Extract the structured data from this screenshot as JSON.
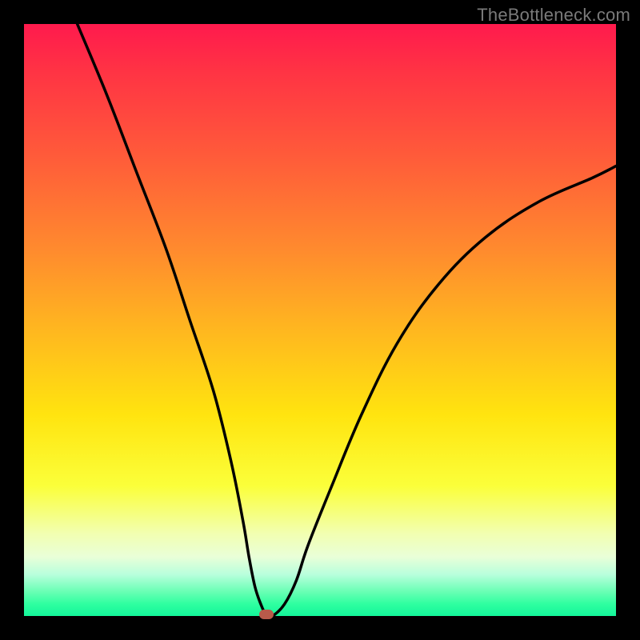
{
  "watermark": "TheBottleneck.com",
  "chart_data": {
    "type": "line",
    "title": "",
    "xlabel": "",
    "ylabel": "",
    "xlim": [
      0,
      100
    ],
    "ylim": [
      0,
      100
    ],
    "grid": false,
    "legend": false,
    "series": [
      {
        "name": "curve",
        "x": [
          9,
          14,
          19,
          24,
          28,
          32,
          35,
          37,
          38,
          39,
          40,
          41,
          42,
          44,
          46,
          48,
          52,
          57,
          63,
          70,
          78,
          87,
          96,
          100
        ],
        "values": [
          100,
          88,
          75,
          62,
          50,
          38,
          26,
          16,
          10,
          5,
          2,
          0,
          0,
          2,
          6,
          12,
          22,
          34,
          46,
          56,
          64,
          70,
          74,
          76
        ]
      }
    ],
    "marker": {
      "x": 41,
      "y": 0
    },
    "gradient_colors": {
      "top": "#ff1a4d",
      "mid": "#ffe40f",
      "bottom": "#14f59a"
    }
  }
}
